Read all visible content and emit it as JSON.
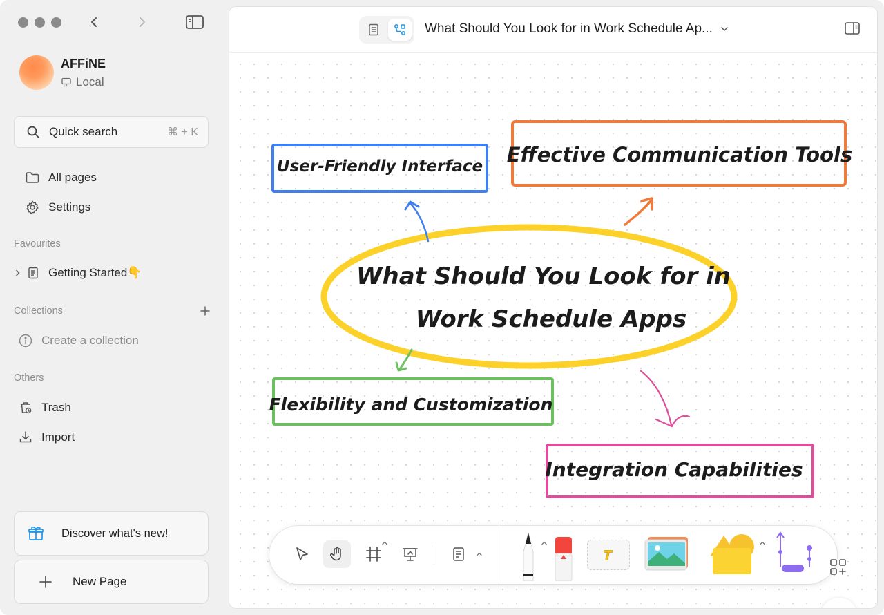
{
  "window": {
    "traffic_lights": [
      "close",
      "minimize",
      "zoom"
    ]
  },
  "sidebar": {
    "workspace": {
      "name": "AFFiNE",
      "type": "Local"
    },
    "search": {
      "label": "Quick search",
      "shortcut": "⌘ + K"
    },
    "nav": {
      "all_pages": "All pages",
      "settings": "Settings"
    },
    "favourites": {
      "label": "Favourites",
      "items": [
        {
          "label": "Getting Started👇"
        }
      ]
    },
    "collections": {
      "label": "Collections",
      "create": "Create a collection"
    },
    "others": {
      "label": "Others",
      "trash": "Trash",
      "import": "Import"
    },
    "discover": "Discover what's new!",
    "new_page": "New Page"
  },
  "header": {
    "modes": [
      "page",
      "edgeless"
    ],
    "active_mode": "edgeless",
    "title": "What Should You Look for in Work Schedule Ap..."
  },
  "mindmap": {
    "central": {
      "line1": "What Should You Look for in",
      "line2": "Work Schedule Apps",
      "color": "#fcd12a"
    },
    "nodes": [
      {
        "id": "ui",
        "label": "User-Friendly Interface",
        "color": "#3f7ff0"
      },
      {
        "id": "comm",
        "label": "Effective Communication Tools",
        "color": "#f07a3a"
      },
      {
        "id": "flex",
        "label": "Flexibility and Customization",
        "color": "#6cc060"
      },
      {
        "id": "integ",
        "label": "Integration Capabilities",
        "color": "#dd4f9b"
      }
    ]
  },
  "toolbar": {
    "tools": [
      "pointer-tool",
      "hand-tool",
      "frame-tool",
      "presentation-tool",
      "note-tool",
      "pen-tool",
      "eraser-tool",
      "text-tool",
      "image-tool",
      "shape-tool",
      "connector-tool"
    ],
    "active": "hand-tool",
    "more": "..."
  }
}
